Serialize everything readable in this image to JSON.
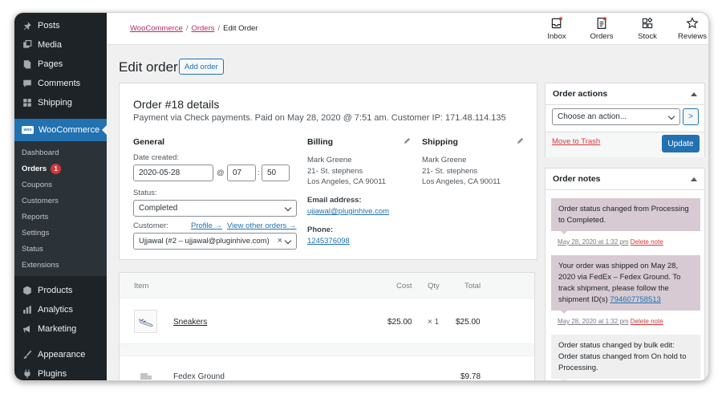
{
  "sidebar": {
    "top_items": [
      {
        "label": "Posts",
        "icon": "pin-icon"
      },
      {
        "label": "Media",
        "icon": "media-icon"
      },
      {
        "label": "Pages",
        "icon": "pages-icon"
      },
      {
        "label": "Comments",
        "icon": "comment-icon"
      },
      {
        "label": "Shipping",
        "icon": "grid-icon"
      }
    ],
    "woocommerce": {
      "label": "WooCommerce",
      "badge_text": "woo"
    },
    "submenu": [
      {
        "label": "Dashboard"
      },
      {
        "label": "Orders",
        "count": "1"
      },
      {
        "label": "Coupons"
      },
      {
        "label": "Customers"
      },
      {
        "label": "Reports"
      },
      {
        "label": "Settings"
      },
      {
        "label": "Status"
      },
      {
        "label": "Extensions"
      }
    ],
    "bottom_items": [
      {
        "label": "Products",
        "icon": "box-icon"
      },
      {
        "label": "Analytics",
        "icon": "bar-chart-icon"
      },
      {
        "label": "Marketing",
        "icon": "megaphone-icon"
      },
      {
        "label": "Appearance",
        "icon": "brush-icon"
      },
      {
        "label": "Plugins",
        "icon": "plug-icon"
      }
    ]
  },
  "breadcrumb": {
    "root": "WooCommerce",
    "parent": "Orders",
    "current": "Edit Order",
    "separator": "/"
  },
  "toolbar": [
    {
      "label": "Inbox",
      "icon": "inbox-icon"
    },
    {
      "label": "Orders",
      "icon": "orders-icon"
    },
    {
      "label": "Stock",
      "icon": "stock-icon"
    },
    {
      "label": "Reviews",
      "icon": "star-icon"
    }
  ],
  "page": {
    "title": "Edit order",
    "add_button": "Add order"
  },
  "order": {
    "heading": "Order #18 details",
    "meta": "Payment via Check payments. Paid on May 28, 2020 @ 7:51 am. Customer IP: 171.48.114.135",
    "general": {
      "heading": "General",
      "date_label": "Date created:",
      "date": "2020-05-28",
      "at": "@",
      "hour": "07",
      "colon": ":",
      "minute": "50",
      "status_label": "Status:",
      "status": "Completed",
      "customer_label": "Customer:",
      "profile_link": "Profile →",
      "other_orders_link": "View other orders →",
      "customer": "Ujjawal (#2 – ujjawal@pluginhive.com)",
      "clear": "×"
    },
    "billing": {
      "heading": "Billing",
      "address": "Mark Greene\n21- St. stephens\nLos Angeles, CA 90011",
      "email_label": "Email address:",
      "email": "ujjawal@pluginhive.com",
      "phone_label": "Phone:",
      "phone": "1245376098"
    },
    "shipping": {
      "heading": "Shipping",
      "address": "Mark Greene\n21- St. stephens\nLos Angeles, CA 90011"
    }
  },
  "items": {
    "headers": {
      "item": "Item",
      "cost": "Cost",
      "qty": "Qty",
      "total": "Total"
    },
    "product": {
      "name": "Sneakers",
      "cost": "$25.00",
      "qty": "× 1",
      "total": "$25.00"
    },
    "shipping_line": {
      "name": "Fedex Ground",
      "total": "$9.78"
    }
  },
  "order_actions": {
    "title": "Order actions",
    "select": "Choose an action...",
    "go": ">",
    "trash": "Move to Trash",
    "update": "Update"
  },
  "order_notes": {
    "title": "Order notes",
    "notes": [
      {
        "text": "Order status changed from Processing to Completed.",
        "date": "May 28, 2020 at 1:32 pm",
        "delete": "Delete note"
      },
      {
        "text": "Your order was shipped on May 28, 2020 via FedEx – Fedex Ground. To track shipment, please follow the shipment ID(s) ",
        "tracking": "794607758513",
        "date": "May 28, 2020 at 1:32 pm",
        "delete": "Delete note"
      },
      {
        "text": "Order status changed by bulk edit: Order status changed from On hold to Processing."
      }
    ]
  },
  "colors": {
    "sidebar": "#1d2327",
    "accent": "#2271b1",
    "woo_link": "#b32d6a",
    "customer_note": "#d7cad2",
    "danger": "#d63638"
  }
}
